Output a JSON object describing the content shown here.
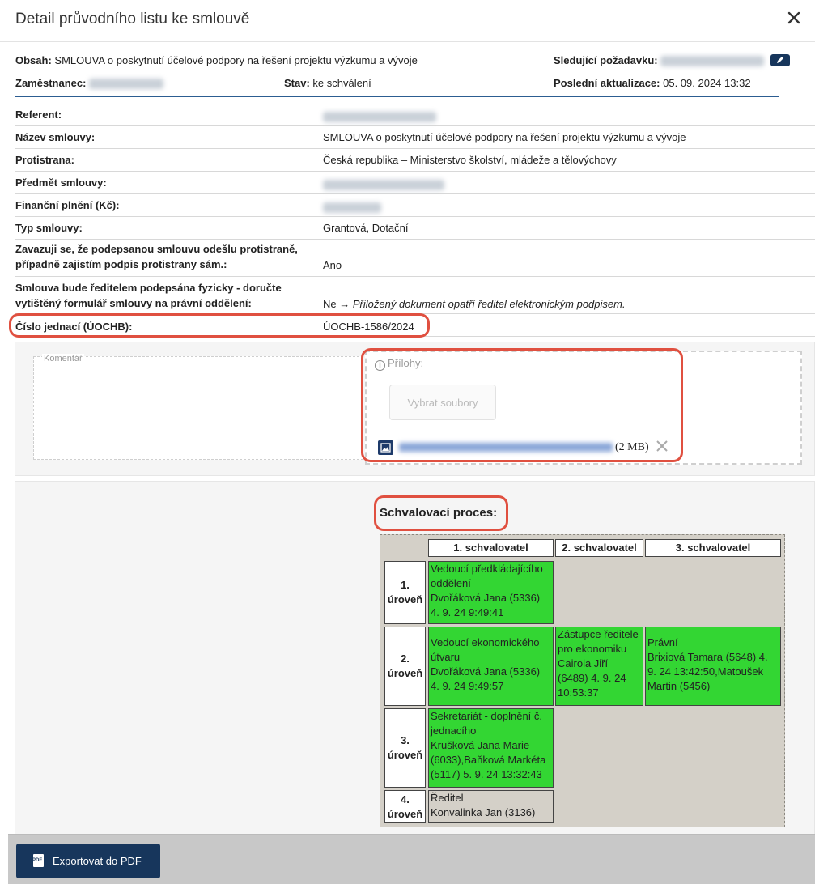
{
  "dialog": {
    "title": "Detail průvodního listu ke smlouvě"
  },
  "header_info": {
    "obsah_label": "Obsah:",
    "obsah_value": "SMLOUVA o poskytnutí účelové podpory na řešení projektu výzkumu a vývoje",
    "sledujici_label": "Sledující požadavku:",
    "zamestnanec_label": "Zaměstnanec:",
    "stav_label": "Stav:",
    "stav_value": "ke schválení",
    "posledni_label": "Poslední aktualizace:",
    "posledni_value": "05. 09. 2024 13:32"
  },
  "details": [
    {
      "label": "Referent:",
      "value": ""
    },
    {
      "label": "Název smlouvy:",
      "value": "SMLOUVA o poskytnutí účelové podpory na řešení projektu výzkumu a vývoje"
    },
    {
      "label": "Protistrana:",
      "value": "Česká republika – Ministerstvo školství, mládeže a tělovýchovy"
    },
    {
      "label": "Předmět smlouvy:",
      "value": ""
    },
    {
      "label": "Finanční plnění (Kč):",
      "value": ""
    },
    {
      "label": "Typ smlouvy:",
      "value": "Grantová, Dotační"
    },
    {
      "label_1": "Zavazuji se, že podepsanou smlouvu odešlu protistraně,",
      "label_2": "případně zajistím podpis protistrany sám.:",
      "value": "Ano"
    },
    {
      "label_1": "Smlouva bude ředitelem podepsána fyzicky - doručte",
      "label_2": "vytištěný formulář smlouvy na právní oddělení:",
      "value": "Ne →",
      "value_italic": "Přiložený dokument opatří ředitel elektronickým podpisem."
    },
    {
      "label": "Číslo jednací (ÚOCHB):",
      "value": "ÚOCHB-1586/2024"
    }
  ],
  "form": {
    "comment_label": "Komentář",
    "attachments_label": "Přílohy:",
    "choose_files": "Vybrat soubory",
    "file_size": "(2 MB)"
  },
  "approval": {
    "title": "Schvalovací proces:",
    "columns": [
      "1. schvalovatel",
      "2. schvalovatel",
      "3. schvalovatel"
    ],
    "levels": [
      {
        "l1": "1.",
        "l2": "úroveň"
      },
      {
        "l1": "2.",
        "l2": "úroveň"
      },
      {
        "l1": "3.",
        "l2": "úroveň"
      },
      {
        "l1": "4.",
        "l2": "úroveň"
      }
    ],
    "cells": {
      "r1c1": [
        "Vedoucí předkládajícího",
        "oddělení",
        "Dvořáková Jana (5336)",
        "4. 9. 24 9:49:41"
      ],
      "r2c1": [
        "Vedoucí ekonomického",
        "útvaru",
        "Dvořáková Jana (5336)",
        "4. 9. 24 9:49:57"
      ],
      "r2c2": [
        "Zástupce ředitele",
        "pro ekonomiku",
        "Cairola Jiří",
        "(6489) 4. 9. 24",
        "10:53:37"
      ],
      "r2c3": [
        "Právní",
        "Brixiová Tamara (5648) 4.",
        "9. 24 13:42:50,Matoušek",
        "Martin (5456)"
      ],
      "r3c1": [
        "Sekretariát - doplnění č.",
        "jednacího",
        "Krušková Jana Marie",
        "(6033),Baňková Markéta",
        "(5117) 5. 9. 24 13:32:43"
      ],
      "r4c1": [
        "Ředitel",
        "Konvalinka Jan (3136)"
      ]
    }
  },
  "footer": {
    "export_button": "Exportovat do PDF"
  },
  "colors": {
    "approved": "#33d633",
    "pending": "#d4d0c8",
    "primary": "#17365c",
    "highlight": "#e05040"
  },
  "icons": [
    "close-icon",
    "edit-icon",
    "info-icon",
    "image-file-icon",
    "remove-icon",
    "pdf-icon"
  ]
}
